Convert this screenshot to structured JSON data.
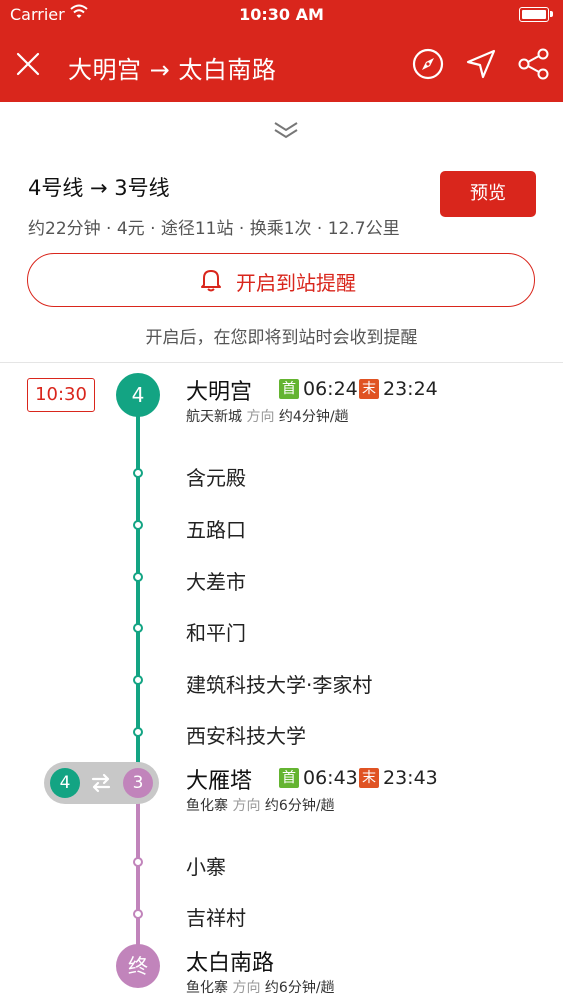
{
  "status_bar": {
    "carrier": "Carrier",
    "time": "10:30 AM"
  },
  "nav": {
    "title": "大明宫 → 太白南路"
  },
  "route": {
    "lines": "4号线 → 3号线",
    "info": "约22分钟 · 4元 · 途径11站 · 换乘1次 · 12.7公里",
    "preview_label": "预览",
    "remind_label": "开启到站提醒",
    "remind_hint": "开启后，在您即将到站时会收到提醒"
  },
  "timeline": {
    "depart_time": "10:30",
    "start": {
      "line_badge": "4",
      "name": "大明宫",
      "first_tag": "首",
      "first_time": "06:24",
      "last_tag": "末",
      "last_time": "23:24",
      "direction_terminal": "航天新城",
      "direction_word": "方向",
      "frequency": "约4分钟/趟"
    },
    "stops_line4": [
      "含元殿",
      "五路口",
      "大差市",
      "和平门",
      "建筑科技大学·李家村",
      "西安科技大学"
    ],
    "transfer": {
      "from_line": "4",
      "to_line": "3",
      "name": "大雁塔",
      "first_tag": "首",
      "first_time": "06:43",
      "last_tag": "末",
      "last_time": "23:43",
      "direction_terminal": "鱼化寨",
      "direction_word": "方向",
      "frequency": "约6分钟/趟"
    },
    "stops_line3": [
      "小寨",
      "吉祥村"
    ],
    "end": {
      "badge": "终",
      "name": "太白南路",
      "direction_terminal": "鱼化寨",
      "direction_word": "方向",
      "frequency": "约6分钟/趟"
    }
  },
  "colors": {
    "brand_red": "#d9261c",
    "line4_green": "#13a483",
    "line3_purple": "#c184bb",
    "first_tag_green": "#64b431",
    "last_tag_orange": "#e05323"
  }
}
